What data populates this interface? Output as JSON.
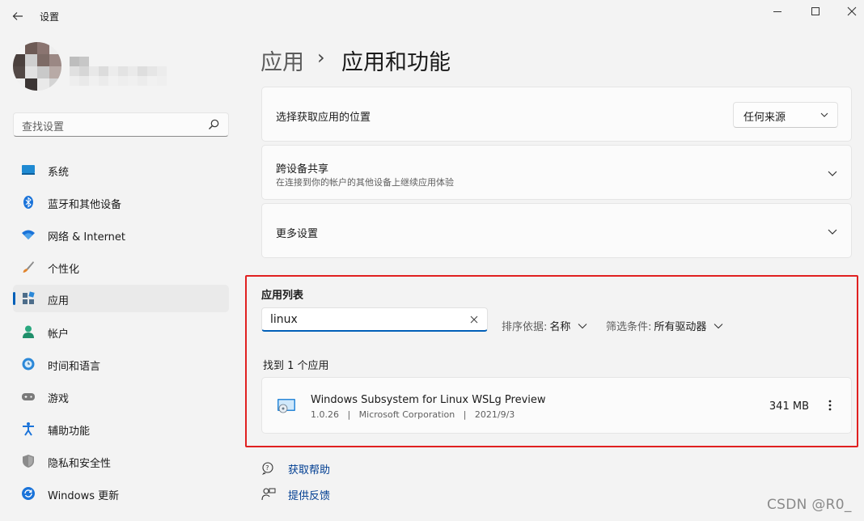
{
  "window": {
    "title": "设置",
    "back_icon": "back-arrow-icon",
    "controls": [
      "minimize-icon",
      "maximize-icon",
      "close-icon"
    ]
  },
  "search": {
    "placeholder": "查找设置",
    "icon": "search-icon"
  },
  "sidebar": {
    "items": [
      {
        "label": "系统",
        "icon": "system-display-icon",
        "active": false
      },
      {
        "label": "蓝牙和其他设备",
        "icon": "bluetooth-icon",
        "active": false
      },
      {
        "label": "网络 & Internet",
        "icon": "wifi-icon",
        "active": false
      },
      {
        "label": "个性化",
        "icon": "brush-icon",
        "active": false
      },
      {
        "label": "应用",
        "icon": "apps-icon",
        "active": true
      },
      {
        "label": "帐户",
        "icon": "person-icon",
        "active": false
      },
      {
        "label": "时间和语言",
        "icon": "globe-clock-icon",
        "active": false
      },
      {
        "label": "游戏",
        "icon": "gamepad-icon",
        "active": false
      },
      {
        "label": "辅助功能",
        "icon": "accessibility-icon",
        "active": false
      },
      {
        "label": "隐私和安全性",
        "icon": "shield-icon",
        "active": false
      },
      {
        "label": "Windows 更新",
        "icon": "update-icon",
        "active": false
      }
    ]
  },
  "breadcrumb": {
    "parent": "应用",
    "separator": "›",
    "current": "应用和功能"
  },
  "cards": {
    "install_source": {
      "title": "选择获取应用的位置",
      "dropdown_value": "任何来源"
    },
    "share": {
      "title": "跨设备共享",
      "subtitle": "在连接到你的帐户的其他设备上继续应用体验"
    },
    "more": {
      "title": "更多设置"
    }
  },
  "app_list": {
    "title": "应用列表",
    "filter_value": "linux",
    "sort_label": "排序依据:",
    "sort_value": "名称",
    "filter_label": "筛选条件:",
    "filter_drive": "所有驱动器",
    "found_text": "找到 1 个应用",
    "apps": [
      {
        "name": "Windows Subsystem for Linux WSLg Preview",
        "version": "1.0.26",
        "publisher": "Microsoft Corporation",
        "date": "2021/9/3",
        "size": "341 MB",
        "meta_line": "1.0.26   |   Microsoft Corporation   |   2021/9/3"
      }
    ]
  },
  "links": {
    "help": "获取帮助",
    "feedback": "提供反馈"
  },
  "watermark": "CSDN @R0_",
  "colors": {
    "accent": "#005fb8",
    "highlight_box": "#e02020",
    "background": "#f3f3f3"
  }
}
